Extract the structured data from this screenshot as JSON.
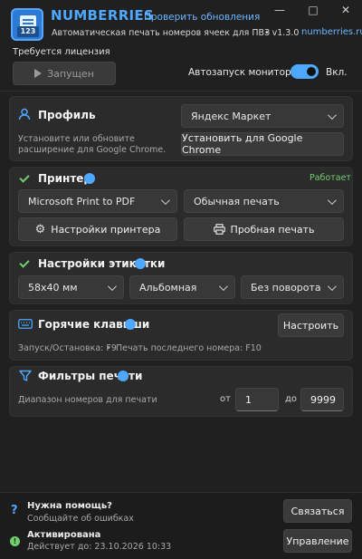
{
  "app": {
    "name": "NUMBERRIES",
    "update_link": "Проверить обновления",
    "subtitle": "Автоматическая печать номеров ячеек для ПВЗ",
    "version": "• v1.3.0",
    "site": "numberries.ru",
    "icon_number": "123"
  },
  "window": {
    "minimize": "—",
    "maximize": "□",
    "close": "✕"
  },
  "license": "Требуется лицензия",
  "run_button": "Запущен",
  "autostart": {
    "label": "Автозапуск мониторинга",
    "state": "Вкл."
  },
  "profile": {
    "title": "Профиль",
    "hint": "Установите или обновите расширение для Google Chrome.",
    "marketplace": "Яндекс Маркет",
    "install_button": "Установить для Google Chrome"
  },
  "printer": {
    "title": "Принтер",
    "status": "Работает",
    "device": "Microsoft Print to PDF",
    "mode": "Обычная печать",
    "settings_button": "Настройки принтера",
    "test_button": "Пробная печать"
  },
  "label_settings": {
    "title": "Настройки этикетки",
    "size": "58x40 мм",
    "orientation": "Альбомная",
    "rotation": "Без поворота"
  },
  "hotkeys": {
    "title": "Горячие клавиши",
    "configure_button": "Настроить",
    "start_stop": "Запуск/Остановка: F9",
    "separator": "•",
    "reprint": "Печать последнего номера: F10"
  },
  "filters": {
    "title": "Фильтры печати",
    "range_label": "Диапазон номеров для печати",
    "from_label": "от",
    "from_value": "1",
    "to_label": "до",
    "to_value": "9999"
  },
  "help": {
    "title": "Нужна помощь?",
    "subtitle": "Сообщайте об ошибках",
    "button": "Связаться",
    "icon": "?"
  },
  "activation": {
    "title": "Активирована",
    "valid_until": "Действует до: 23.10.2026 10:33",
    "button": "Управление",
    "icon": "!"
  }
}
